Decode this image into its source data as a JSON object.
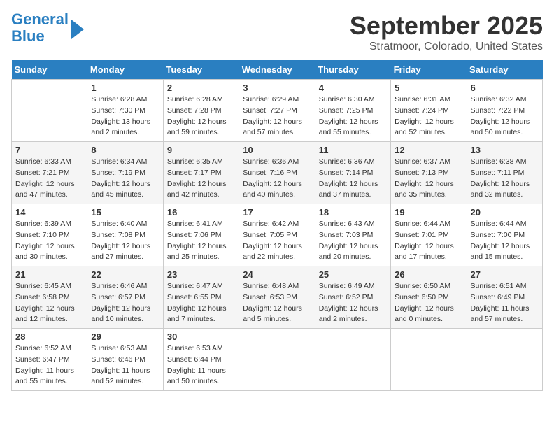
{
  "logo": {
    "line1": "General",
    "line2": "Blue",
    "arrow": true
  },
  "title": "September 2025",
  "subtitle": "Stratmoor, Colorado, United States",
  "weekdays": [
    "Sunday",
    "Monday",
    "Tuesday",
    "Wednesday",
    "Thursday",
    "Friday",
    "Saturday"
  ],
  "weeks": [
    [
      {
        "day": "",
        "info": ""
      },
      {
        "day": "1",
        "info": "Sunrise: 6:28 AM\nSunset: 7:30 PM\nDaylight: 13 hours\nand 2 minutes."
      },
      {
        "day": "2",
        "info": "Sunrise: 6:28 AM\nSunset: 7:28 PM\nDaylight: 12 hours\nand 59 minutes."
      },
      {
        "day": "3",
        "info": "Sunrise: 6:29 AM\nSunset: 7:27 PM\nDaylight: 12 hours\nand 57 minutes."
      },
      {
        "day": "4",
        "info": "Sunrise: 6:30 AM\nSunset: 7:25 PM\nDaylight: 12 hours\nand 55 minutes."
      },
      {
        "day": "5",
        "info": "Sunrise: 6:31 AM\nSunset: 7:24 PM\nDaylight: 12 hours\nand 52 minutes."
      },
      {
        "day": "6",
        "info": "Sunrise: 6:32 AM\nSunset: 7:22 PM\nDaylight: 12 hours\nand 50 minutes."
      }
    ],
    [
      {
        "day": "7",
        "info": "Sunrise: 6:33 AM\nSunset: 7:21 PM\nDaylight: 12 hours\nand 47 minutes."
      },
      {
        "day": "8",
        "info": "Sunrise: 6:34 AM\nSunset: 7:19 PM\nDaylight: 12 hours\nand 45 minutes."
      },
      {
        "day": "9",
        "info": "Sunrise: 6:35 AM\nSunset: 7:17 PM\nDaylight: 12 hours\nand 42 minutes."
      },
      {
        "day": "10",
        "info": "Sunrise: 6:36 AM\nSunset: 7:16 PM\nDaylight: 12 hours\nand 40 minutes."
      },
      {
        "day": "11",
        "info": "Sunrise: 6:36 AM\nSunset: 7:14 PM\nDaylight: 12 hours\nand 37 minutes."
      },
      {
        "day": "12",
        "info": "Sunrise: 6:37 AM\nSunset: 7:13 PM\nDaylight: 12 hours\nand 35 minutes."
      },
      {
        "day": "13",
        "info": "Sunrise: 6:38 AM\nSunset: 7:11 PM\nDaylight: 12 hours\nand 32 minutes."
      }
    ],
    [
      {
        "day": "14",
        "info": "Sunrise: 6:39 AM\nSunset: 7:10 PM\nDaylight: 12 hours\nand 30 minutes."
      },
      {
        "day": "15",
        "info": "Sunrise: 6:40 AM\nSunset: 7:08 PM\nDaylight: 12 hours\nand 27 minutes."
      },
      {
        "day": "16",
        "info": "Sunrise: 6:41 AM\nSunset: 7:06 PM\nDaylight: 12 hours\nand 25 minutes."
      },
      {
        "day": "17",
        "info": "Sunrise: 6:42 AM\nSunset: 7:05 PM\nDaylight: 12 hours\nand 22 minutes."
      },
      {
        "day": "18",
        "info": "Sunrise: 6:43 AM\nSunset: 7:03 PM\nDaylight: 12 hours\nand 20 minutes."
      },
      {
        "day": "19",
        "info": "Sunrise: 6:44 AM\nSunset: 7:01 PM\nDaylight: 12 hours\nand 17 minutes."
      },
      {
        "day": "20",
        "info": "Sunrise: 6:44 AM\nSunset: 7:00 PM\nDaylight: 12 hours\nand 15 minutes."
      }
    ],
    [
      {
        "day": "21",
        "info": "Sunrise: 6:45 AM\nSunset: 6:58 PM\nDaylight: 12 hours\nand 12 minutes."
      },
      {
        "day": "22",
        "info": "Sunrise: 6:46 AM\nSunset: 6:57 PM\nDaylight: 12 hours\nand 10 minutes."
      },
      {
        "day": "23",
        "info": "Sunrise: 6:47 AM\nSunset: 6:55 PM\nDaylight: 12 hours\nand 7 minutes."
      },
      {
        "day": "24",
        "info": "Sunrise: 6:48 AM\nSunset: 6:53 PM\nDaylight: 12 hours\nand 5 minutes."
      },
      {
        "day": "25",
        "info": "Sunrise: 6:49 AM\nSunset: 6:52 PM\nDaylight: 12 hours\nand 2 minutes."
      },
      {
        "day": "26",
        "info": "Sunrise: 6:50 AM\nSunset: 6:50 PM\nDaylight: 12 hours\nand 0 minutes."
      },
      {
        "day": "27",
        "info": "Sunrise: 6:51 AM\nSunset: 6:49 PM\nDaylight: 11 hours\nand 57 minutes."
      }
    ],
    [
      {
        "day": "28",
        "info": "Sunrise: 6:52 AM\nSunset: 6:47 PM\nDaylight: 11 hours\nand 55 minutes."
      },
      {
        "day": "29",
        "info": "Sunrise: 6:53 AM\nSunset: 6:46 PM\nDaylight: 11 hours\nand 52 minutes."
      },
      {
        "day": "30",
        "info": "Sunrise: 6:53 AM\nSunset: 6:44 PM\nDaylight: 11 hours\nand 50 minutes."
      },
      {
        "day": "",
        "info": ""
      },
      {
        "day": "",
        "info": ""
      },
      {
        "day": "",
        "info": ""
      },
      {
        "day": "",
        "info": ""
      }
    ]
  ]
}
